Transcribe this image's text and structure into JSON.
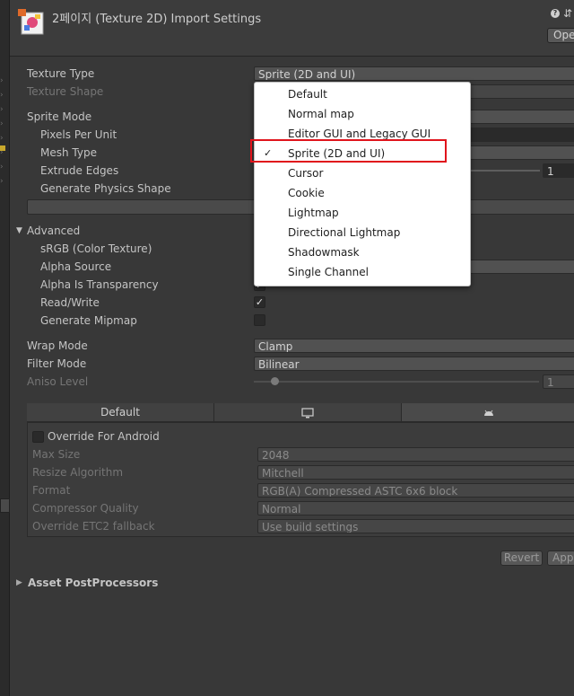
{
  "header": {
    "title": "2페이지 (Texture 2D) Import Settings",
    "open_label": "Ope"
  },
  "settings": {
    "texture_type_label": "Texture Type",
    "texture_type_value": "Sprite (2D and UI)",
    "texture_shape_label": "Texture Shape",
    "sprite_mode_label": "Sprite Mode",
    "pixels_per_unit_label": "Pixels Per Unit",
    "mesh_type_label": "Mesh Type",
    "extrude_edges_label": "Extrude Edges",
    "extrude_edges_value": "1",
    "generate_physics_shape_label": "Generate Physics Shape",
    "advanced_label": "Advanced",
    "srgb_label": "sRGB (Color Texture)",
    "alpha_source_label": "Alpha Source",
    "alpha_is_transparency_label": "Alpha Is Transparency",
    "read_write_label": "Read/Write",
    "generate_mipmap_label": "Generate Mipmap",
    "wrap_mode_label": "Wrap Mode",
    "wrap_mode_value": "Clamp",
    "filter_mode_label": "Filter Mode",
    "filter_mode_value": "Bilinear",
    "aniso_level_label": "Aniso Level",
    "aniso_level_value": "1"
  },
  "dropdown": {
    "items": [
      "Default",
      "Normal map",
      "Editor GUI and Legacy GUI",
      "Sprite (2D and UI)",
      "Cursor",
      "Cookie",
      "Lightmap",
      "Directional Lightmap",
      "Shadowmask",
      "Single Channel"
    ],
    "checkmark": "✓"
  },
  "platform": {
    "tab_default": "Default",
    "override_label": "Override For Android",
    "max_size_label": "Max Size",
    "max_size_value": "2048",
    "resize_algorithm_label": "Resize Algorithm",
    "resize_algorithm_value": "Mitchell",
    "format_label": "Format",
    "format_value": "RGB(A) Compressed ASTC 6x6 block",
    "compressor_quality_label": "Compressor Quality",
    "compressor_quality_value": "Normal",
    "override_etc2_label": "Override ETC2 fallback",
    "override_etc2_value": "Use build settings"
  },
  "buttons": {
    "revert": "Revert",
    "apply": "App"
  },
  "footer": {
    "asset_postprocessors": "Asset PostProcessors"
  },
  "colors": {
    "background": "#383838",
    "highlight": "#e0141c",
    "menu_background": "#ffffff"
  }
}
